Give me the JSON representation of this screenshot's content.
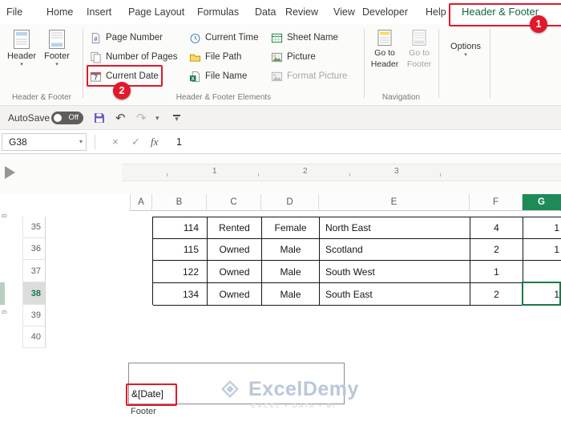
{
  "menubar": {
    "tabs": [
      "File",
      "Home",
      "Insert",
      "Page Layout",
      "Formulas",
      "Data",
      "Review",
      "View",
      "Developer",
      "Help",
      "Header & Footer"
    ]
  },
  "ribbon": {
    "header_footer_group": {
      "label": "Header & Footer",
      "header_button": "Header",
      "footer_button": "Footer"
    },
    "elements_group": {
      "label": "Header & Footer Elements",
      "page_number": "Page Number",
      "number_of_pages": "Number of Pages",
      "current_date": "Current Date",
      "current_time": "Current Time",
      "file_path": "File Path",
      "file_name": "File Name",
      "sheet_name": "Sheet Name",
      "picture": "Picture",
      "format_picture": "Format Picture"
    },
    "navigation_group": {
      "label": "Navigation",
      "go_to_header_line1": "Go to",
      "go_to_header_line2": "Header",
      "go_to_footer_line1": "Go to",
      "go_to_footer_line2": "Footer"
    },
    "options_group": {
      "options": "Options"
    }
  },
  "qat": {
    "autosave_label": "AutoSave",
    "autosave_state": "Off"
  },
  "formula_bar": {
    "name_box": "G38",
    "fx_label": "fx",
    "value": "1"
  },
  "icons": {
    "undo": "↶",
    "redo": "↷",
    "chevron_down": "▾",
    "cancel": "×",
    "enter": "✓"
  },
  "ruler": {
    "marks": [
      "1",
      "2",
      "3"
    ],
    "v_marks": [
      "8",
      "9"
    ]
  },
  "sheet": {
    "col_headers": [
      "A",
      "B",
      "C",
      "D",
      "E",
      "F",
      "G"
    ],
    "row_headers": [
      "35",
      "36",
      "37",
      "38",
      "39",
      "40"
    ],
    "active_cell": "G38",
    "table_rows": [
      {
        "id": "114",
        "status": "Rented",
        "gender": "Female",
        "region": "North East",
        "count": "4",
        "extra": "1"
      },
      {
        "id": "115",
        "status": "Owned",
        "gender": "Male",
        "region": "Scotland",
        "count": "2",
        "extra": "1"
      },
      {
        "id": "122",
        "status": "Owned",
        "gender": "Male",
        "region": "South West",
        "count": "1",
        "extra": ""
      },
      {
        "id": "134",
        "status": "Owned",
        "gender": "Male",
        "region": "South East",
        "count": "2",
        "extra": "1"
      }
    ]
  },
  "footer_area": {
    "date_code": "&[Date]",
    "label": "Footer"
  },
  "watermark": {
    "brand": "ExcelDemy",
    "tagline": "EXCEL • DATA • BI"
  },
  "annotations": {
    "step1": "1",
    "step2": "2"
  },
  "colors": {
    "excel_green": "#107c41",
    "selected_header_green": "#1e8a58",
    "annotation_red": "#e0192d",
    "watermark_blue": "#bac7d8"
  }
}
